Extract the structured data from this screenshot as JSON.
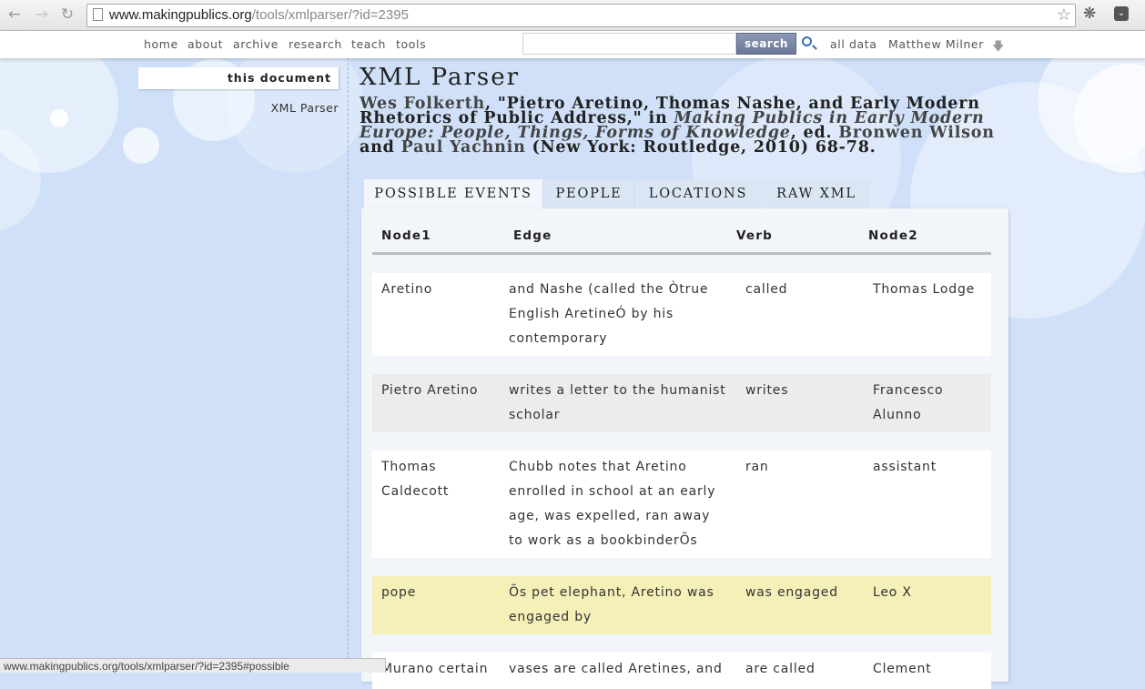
{
  "browser": {
    "url_host": "www.makingpublics.org",
    "url_path": "/tools/xmlparser/?id=2395",
    "status_url": "www.makingpublics.org/tools/xmlparser/?id=2395#possible"
  },
  "nav": {
    "items": [
      "home",
      "about",
      "archive",
      "research",
      "teach",
      "tools"
    ],
    "search_button": "search",
    "all_data": "all data",
    "user": "Matthew Milner"
  },
  "sidebar": {
    "heading": "this document",
    "link": "XML Parser"
  },
  "main": {
    "title": "XML Parser",
    "citation": {
      "author": "Wes Folkerth",
      "article": ", \"Pietro Aretino, Thomas Nashe, and Early Modern Rhetorics of Public Address,\" in ",
      "book": "Making Publics in Early Modern Europe: People, Things, Forms of Knowledge",
      "ed": ", ed. ",
      "editor1": "Bronwen Wilson",
      "and": " and ",
      "editor2": "Paul Yachnin",
      "pub": " (New York: Routledge, 2010) 68-78."
    },
    "tabs": [
      "POSSIBLE EVENTS",
      "PEOPLE",
      "LOCATIONS",
      "RAW XML"
    ],
    "table": {
      "headers": [
        "Node1",
        "Edge",
        "Verb",
        "Node2"
      ],
      "rows": [
        [
          "Aretino",
          "and Nashe (called the Òtrue English AretineÓ by his contemporary",
          "called",
          "Thomas Lodge"
        ],
        [
          "Pietro Aretino",
          "writes a letter to the humanist scholar",
          "writes",
          "Francesco Alunno"
        ],
        [
          "Thomas Caldecott",
          "Chubb notes that Aretino enrolled in school at an early age, was expelled, ran away to work as a bookbinderÕs",
          "ran",
          "assistant"
        ],
        [
          "pope",
          "Õs pet elephant, Aretino was engaged by",
          "was engaged",
          "Leo X"
        ],
        [
          "Murano certain",
          "vases are called Aretines, and",
          "are called",
          "Clement"
        ]
      ]
    }
  },
  "colors": {
    "background": "#cfe0f8",
    "row_white": "#ffffff",
    "row_gray": "#ececec",
    "row_highlight": "#f5f0b8",
    "search_button": "#7b88a6"
  }
}
